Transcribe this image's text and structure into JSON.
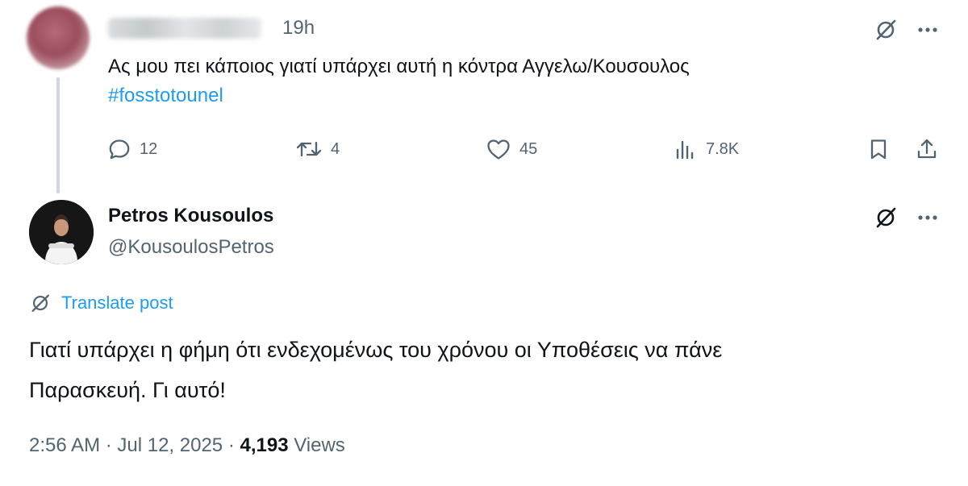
{
  "parent_tweet": {
    "time": "19h",
    "text": "Ας μου πει κάποιος γιατί υπάρχει αυτή η κόντρα Αγγελω/Κουσουλος",
    "hashtag": "#fosstotounel",
    "actions": {
      "replies": "12",
      "reposts": "4",
      "likes": "45",
      "views": "7.8K"
    }
  },
  "main_tweet": {
    "author_name": "Petros Kousoulos",
    "author_handle": "@KousoulosPetros",
    "translate_label": "Translate post",
    "text_line1": "Γιατί υπάρχει η φήμη ότι ενδεχομένως του χρόνου οι Υποθέσεις να πάνε",
    "text_line2": "Παρασκευή. Γι αυτό!",
    "timestamp": "2:56 AM · Jul 12, 2025 · ",
    "views_count": "4,193",
    "views_label": "Views"
  },
  "icons": {
    "grok": "grok-icon",
    "more": "more-icon",
    "reply": "reply-icon",
    "repost": "repost-icon",
    "like": "like-icon",
    "views": "views-icon",
    "bookmark": "bookmark-icon",
    "share": "share-icon",
    "translate": "translate-icon"
  },
  "colors": {
    "accent": "#1d9bf0",
    "secondary_text": "#536471",
    "primary_text": "#0f1419",
    "thread_line": "#cfd9de"
  }
}
